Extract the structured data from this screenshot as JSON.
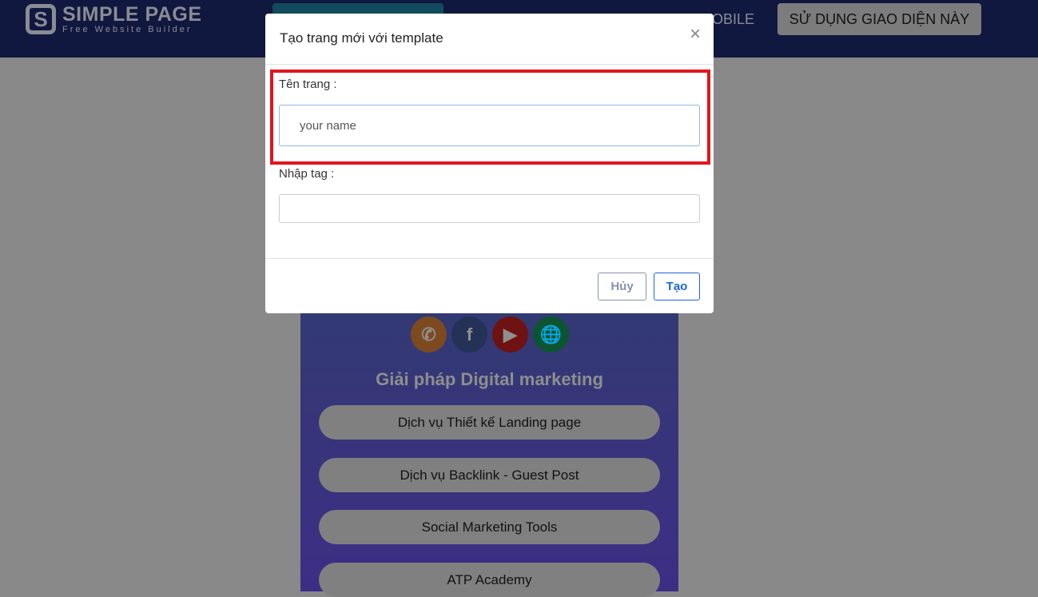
{
  "header": {
    "logo_name": "SIMPLE PAGE",
    "logo_tagline": "Free Website Builder",
    "nav_partial": "MOBILE",
    "use_button": "SỬ DỤNG GIAO DIỆN NÀY"
  },
  "preview": {
    "socials": [
      {
        "icon": "phone-icon",
        "color": "#7d4a1f"
      },
      {
        "icon": "facebook-icon",
        "color": "#233256"
      },
      {
        "icon": "youtube-icon",
        "color": "#6e1212"
      },
      {
        "icon": "globe-icon",
        "color": "#0c5530"
      }
    ],
    "title": "Giải pháp Digital marketing",
    "links": [
      "Dịch vụ Thiết kế Landing page",
      "Dịch vụ Backlink - Guest Post",
      "Social Marketing Tools",
      "ATP Academy"
    ]
  },
  "modal": {
    "title": "Tạo trang mới với template",
    "close": "×",
    "name_label": "Tên trang :",
    "name_value": "your name",
    "tag_label": "Nhập tag :",
    "tag_value": "",
    "cancel": "Hủy",
    "create": "Tạo"
  }
}
